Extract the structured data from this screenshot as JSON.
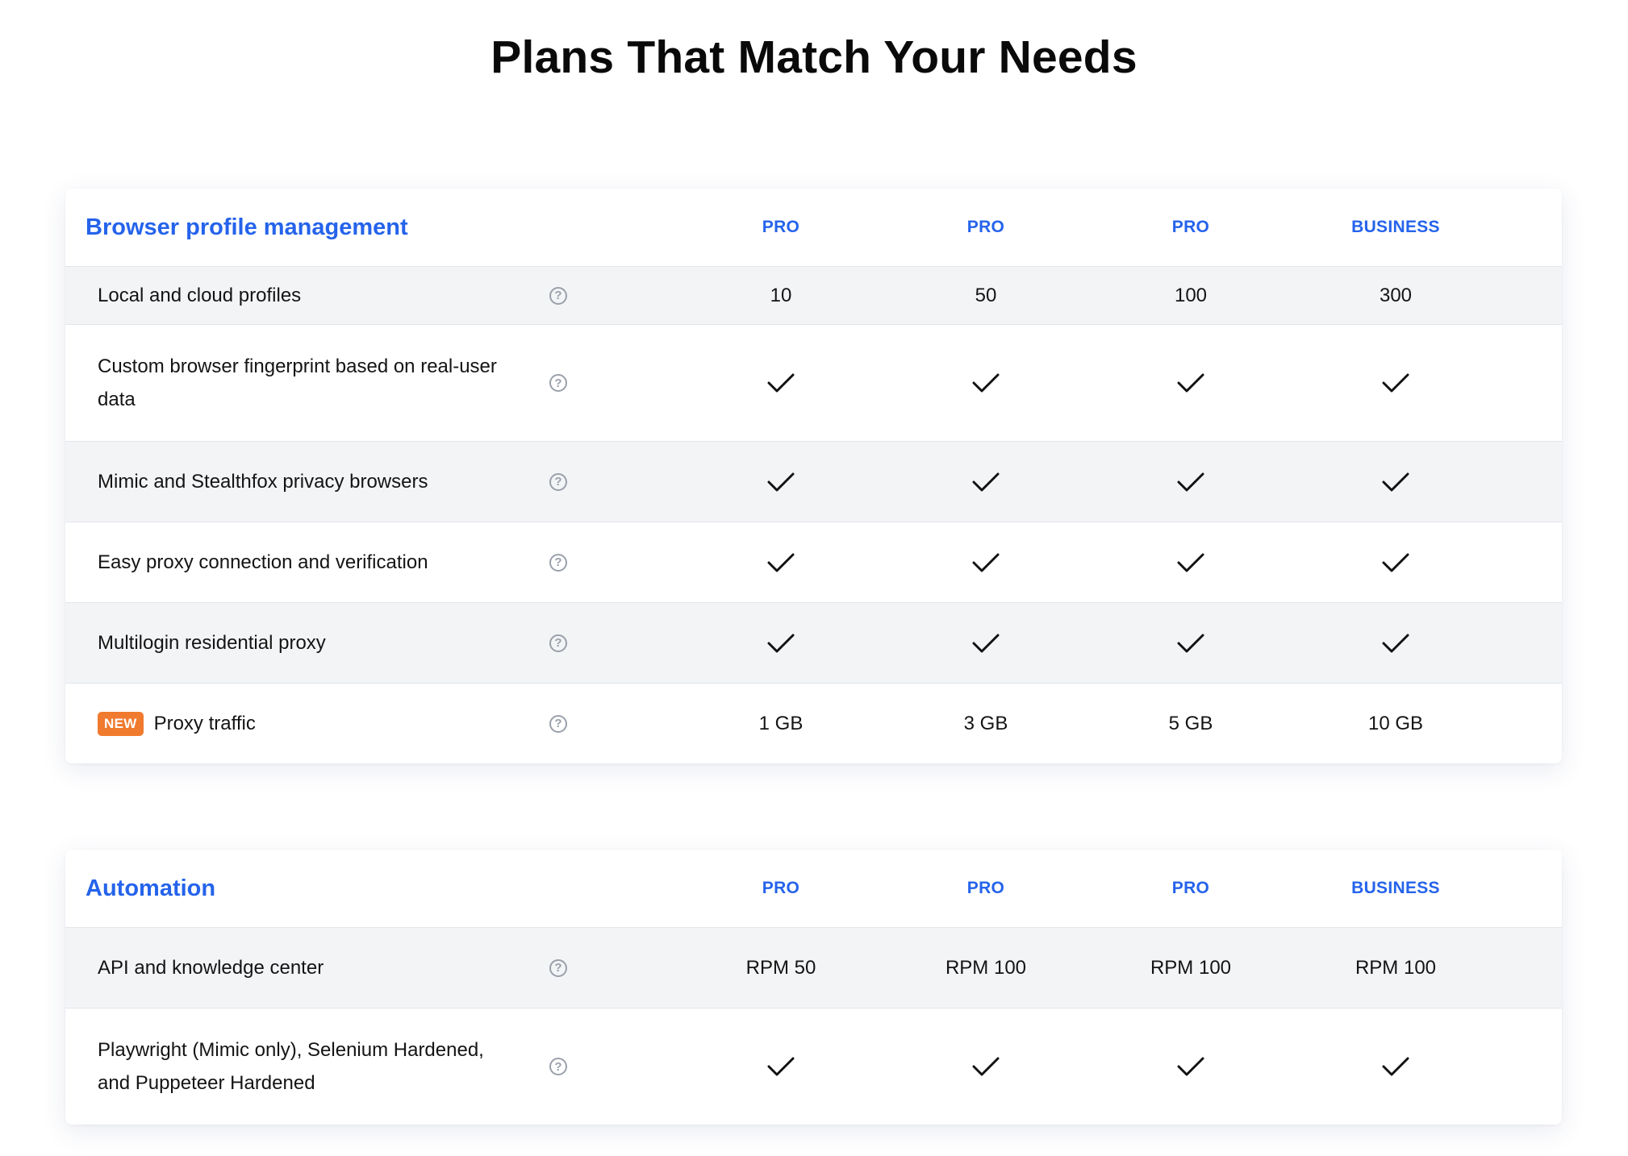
{
  "page": {
    "title": "Plans That Match Your Needs"
  },
  "sections": [
    {
      "title": "Browser profile management",
      "plans": [
        "PRO",
        "PRO",
        "PRO",
        "BUSINESS"
      ],
      "rows": [
        {
          "feature": "Local and cloud profiles",
          "values": [
            "10",
            "50",
            "100",
            "300"
          ]
        },
        {
          "feature": "Custom browser fingerprint based on real-user data",
          "values": [
            "check",
            "check",
            "check",
            "check"
          ]
        },
        {
          "feature": "Mimic and Stealthfox privacy browsers",
          "values": [
            "check",
            "check",
            "check",
            "check"
          ]
        },
        {
          "feature": "Easy proxy connection and verification",
          "values": [
            "check",
            "check",
            "check",
            "check"
          ]
        },
        {
          "feature": "Multilogin residential proxy",
          "values": [
            "check",
            "check",
            "check",
            "check"
          ]
        },
        {
          "feature": "Proxy traffic",
          "badge": "NEW",
          "values": [
            "1 GB",
            "3 GB",
            "5 GB",
            "10 GB"
          ]
        }
      ]
    },
    {
      "title": "Automation",
      "plans": [
        "PRO",
        "PRO",
        "PRO",
        "BUSINESS"
      ],
      "rows": [
        {
          "feature": "API and knowledge center",
          "values": [
            "RPM 50",
            "RPM 100",
            "RPM 100",
            "RPM 100"
          ]
        },
        {
          "feature": "Playwright (Mimic only), Selenium Hardened, and Puppeteer Hardened",
          "values": [
            "check",
            "check",
            "check",
            "check"
          ]
        }
      ]
    }
  ],
  "icons": {
    "help": "help-circle-icon",
    "check": "check-icon"
  },
  "colors": {
    "accent": "#2563eb",
    "badge": "#f07a2e",
    "alt_row": "#f3f4f6"
  }
}
